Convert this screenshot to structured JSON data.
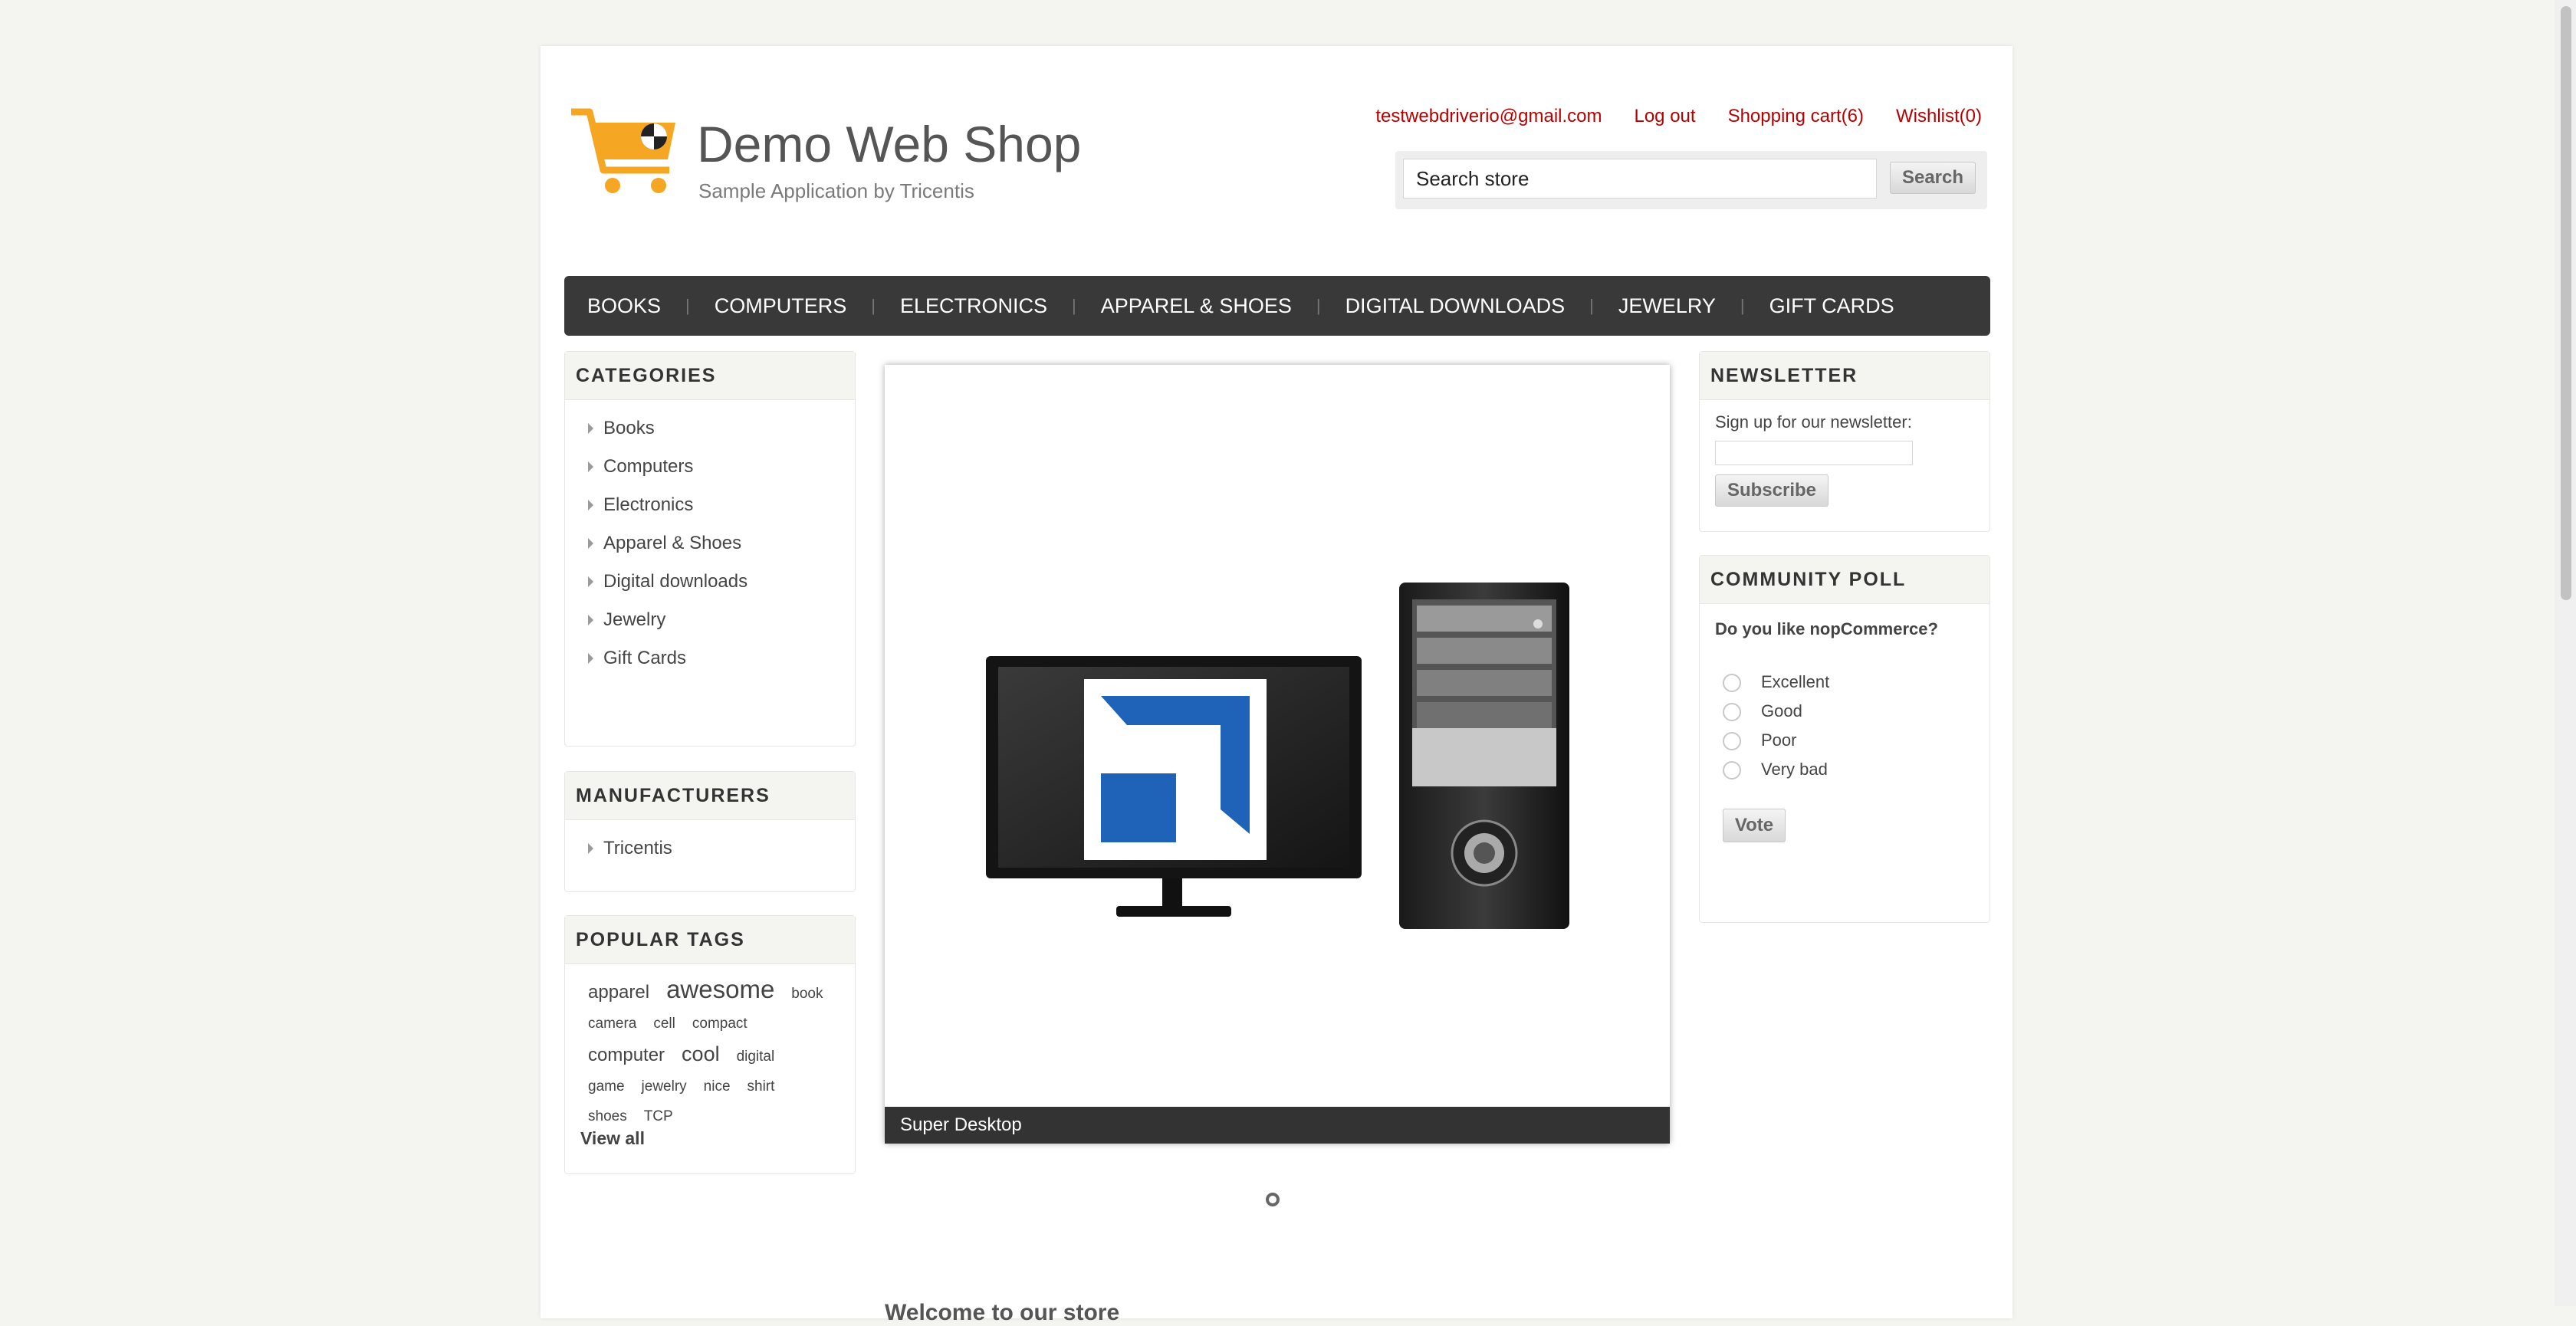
{
  "header": {
    "title": "Demo Web Shop",
    "subtitle": "Sample Application by Tricentis",
    "links": {
      "email": "testwebdriverio@gmail.com",
      "logout": "Log out",
      "cart": "Shopping cart(6)",
      "wishlist": "Wishlist(0)"
    },
    "search": {
      "value": "Search store",
      "button": "Search"
    }
  },
  "nav": [
    "BOOKS",
    "COMPUTERS",
    "ELECTRONICS",
    "APPAREL & SHOES",
    "DIGITAL DOWNLOADS",
    "JEWELRY",
    "GIFT CARDS"
  ],
  "categories": {
    "title": "CATEGORIES",
    "items": [
      "Books",
      "Computers",
      "Electronics",
      "Apparel & Shoes",
      "Digital downloads",
      "Jewelry",
      "Gift Cards"
    ]
  },
  "manufacturers": {
    "title": "MANUFACTURERS",
    "items": [
      "Tricentis"
    ]
  },
  "tags": {
    "title": "POPULAR TAGS",
    "items": [
      "apparel",
      "awesome",
      "book",
      "camera",
      "cell",
      "compact",
      "computer",
      "cool",
      "digital",
      "game",
      "jewelry",
      "nice",
      "shirt",
      "shoes",
      "TCP"
    ],
    "view_all": "View all"
  },
  "slider": {
    "caption": "Super Desktop"
  },
  "welcome": "Welcome to our store",
  "newsletter": {
    "title": "NEWSLETTER",
    "label": "Sign up for our newsletter:",
    "button": "Subscribe"
  },
  "poll": {
    "title": "COMMUNITY POLL",
    "question": "Do you like nopCommerce?",
    "options": [
      "Excellent",
      "Good",
      "Poor",
      "Very bad"
    ],
    "button": "Vote"
  },
  "colors": {
    "link_red": "#b80000",
    "nav_bg": "#393939",
    "logo_orange": "#f5a623",
    "tricentis_blue": "#1e63b8"
  },
  "icons": {
    "logo": "shopping-cart-icon",
    "category_bullet": "triangle-right-icon"
  }
}
